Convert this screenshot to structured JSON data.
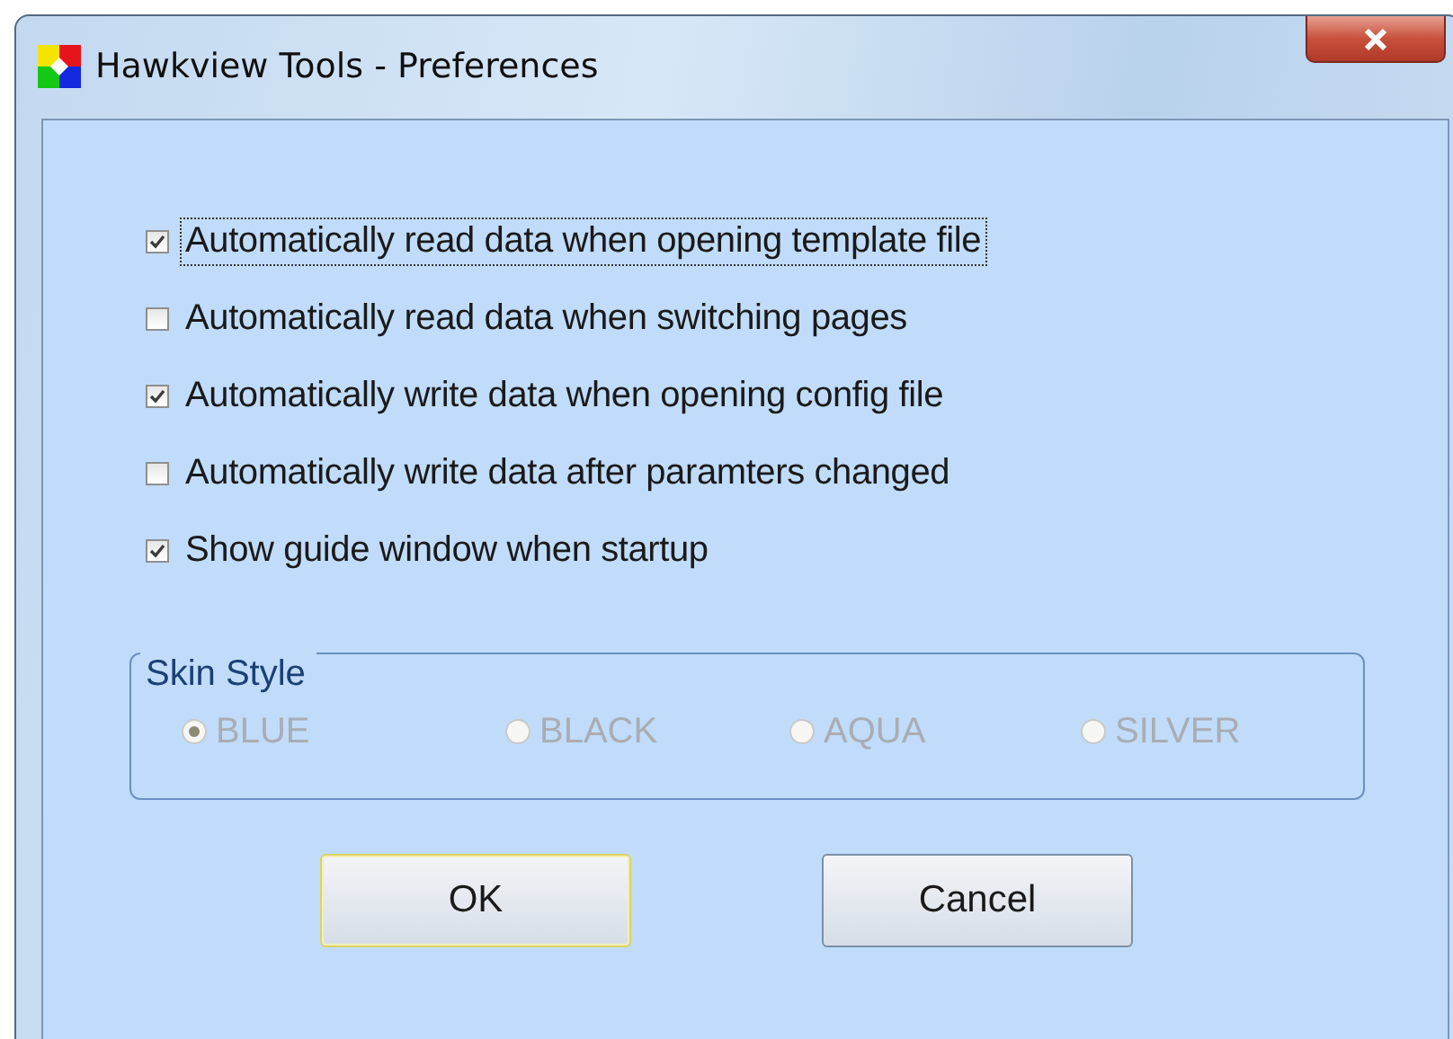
{
  "window": {
    "title": "Hawkview Tools - Preferences"
  },
  "options": [
    {
      "label": "Automatically read data when opening template file",
      "checked": true,
      "focused": true
    },
    {
      "label": "Automatically read data when switching pages",
      "checked": false,
      "focused": false
    },
    {
      "label": "Automatically write data when opening config file",
      "checked": true,
      "focused": false
    },
    {
      "label": "Automatically write data after paramters changed",
      "checked": false,
      "focused": false
    },
    {
      "label": "Show guide window when startup",
      "checked": true,
      "focused": false
    }
  ],
  "skin_style": {
    "title": "Skin Style",
    "choices": [
      {
        "label": "BLUE",
        "selected": true,
        "disabled": true
      },
      {
        "label": "BLACK",
        "selected": false,
        "disabled": true
      },
      {
        "label": "AQUA",
        "selected": false,
        "disabled": true
      },
      {
        "label": "SILVER",
        "selected": false,
        "disabled": true
      }
    ]
  },
  "buttons": [
    {
      "label": "OK",
      "default": true
    },
    {
      "label": "Cancel",
      "default": false
    }
  ]
}
